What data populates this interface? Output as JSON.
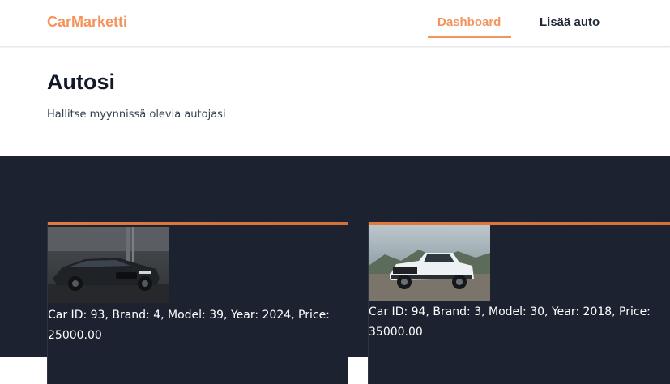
{
  "nav": {
    "brand": "CarMarketti",
    "dashboard_label": "Dashboard",
    "add_car_label": "Lisää auto"
  },
  "header": {
    "title": "Autosi",
    "subtitle": "Hallitse myynnissä olevia autojasi"
  },
  "cars": [
    {
      "description": "Car ID: 93, Brand: 4, Model: 39, Year: 2024, Price: 25000.00",
      "image": "dark-sedan-photo"
    },
    {
      "description": "Car ID: 94, Brand: 3, Model: 30, Year: 2018, Price: 35000.00",
      "image": "white-pickup-truck-photo"
    }
  ],
  "colors": {
    "accent": "#f4935c",
    "dark_background": "#1c2230",
    "card_top_bar": "#e07a3f"
  }
}
